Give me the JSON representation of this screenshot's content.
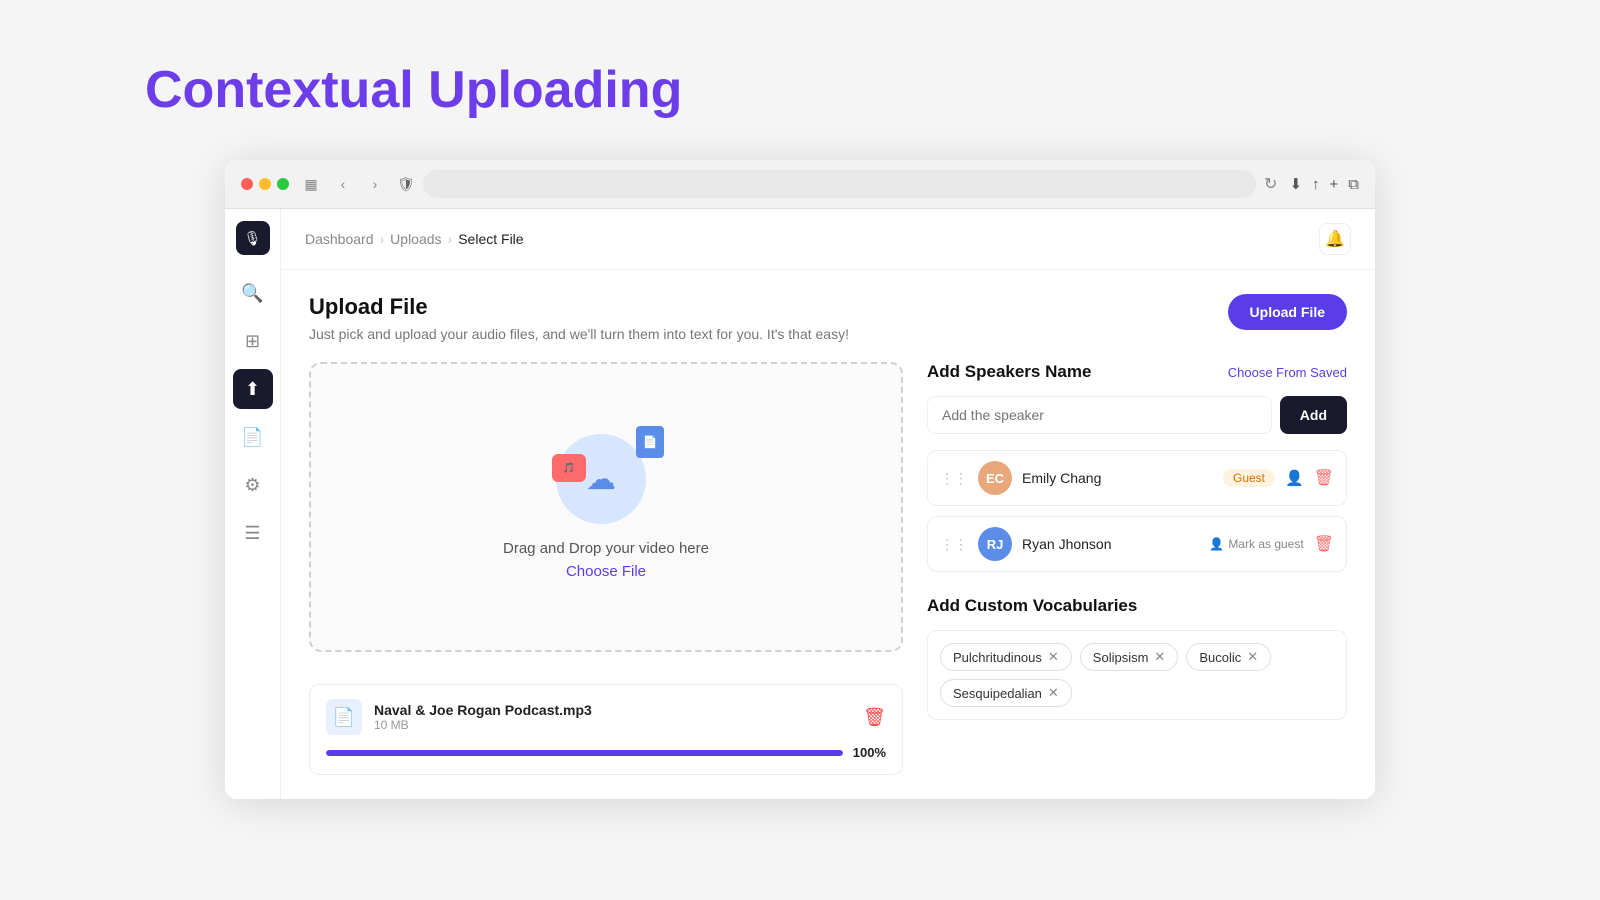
{
  "page": {
    "title_black": "Contextual",
    "title_purple": "Uploading"
  },
  "browser": {
    "url": "",
    "close_label": "×",
    "minimize_label": "–",
    "maximize_label": "+"
  },
  "breadcrumb": {
    "items": [
      "Dashboard",
      "Uploads",
      "Select File"
    ]
  },
  "upload_section": {
    "title": "Upload File",
    "description": "Just pick and upload your audio files, and we'll turn them into text for you. It's that easy!",
    "upload_btn_label": "Upload File",
    "drop_text": "Drag and Drop your video here",
    "choose_file_label": "Choose File",
    "file": {
      "name": "Naval & Joe Rogan Podcast.mp3",
      "size": "10 MB",
      "progress": 100,
      "progress_label": "100%"
    }
  },
  "speakers": {
    "section_title": "Add Speakers Name",
    "choose_saved_label": "Choose From Saved",
    "input_placeholder": "Add the speaker",
    "add_btn_label": "Add",
    "list": [
      {
        "name": "Emily Chang",
        "avatar_color": "#e8a87c",
        "initials": "EC",
        "is_guest": true,
        "guest_badge": "Guest"
      },
      {
        "name": "Ryan Jhonson",
        "avatar_color": "#5b8de8",
        "initials": "RJ",
        "is_guest": false,
        "mark_as_guest_label": "Mark as guest"
      }
    ]
  },
  "vocabularies": {
    "section_title": "Add Custom Vocabularies",
    "tags": [
      {
        "label": "Pulchritudinous"
      },
      {
        "label": "Solipsism"
      },
      {
        "label": "Bucolic"
      },
      {
        "label": "Sesquipedalian"
      }
    ]
  },
  "sidebar": {
    "logo": "🎙",
    "items": [
      {
        "icon": "🔍",
        "name": "search"
      },
      {
        "icon": "⊞",
        "name": "grid"
      },
      {
        "icon": "⬆",
        "name": "upload",
        "active": true
      },
      {
        "icon": "📄",
        "name": "documents"
      },
      {
        "icon": "⚙",
        "name": "settings"
      },
      {
        "icon": "☰",
        "name": "menu"
      }
    ]
  }
}
